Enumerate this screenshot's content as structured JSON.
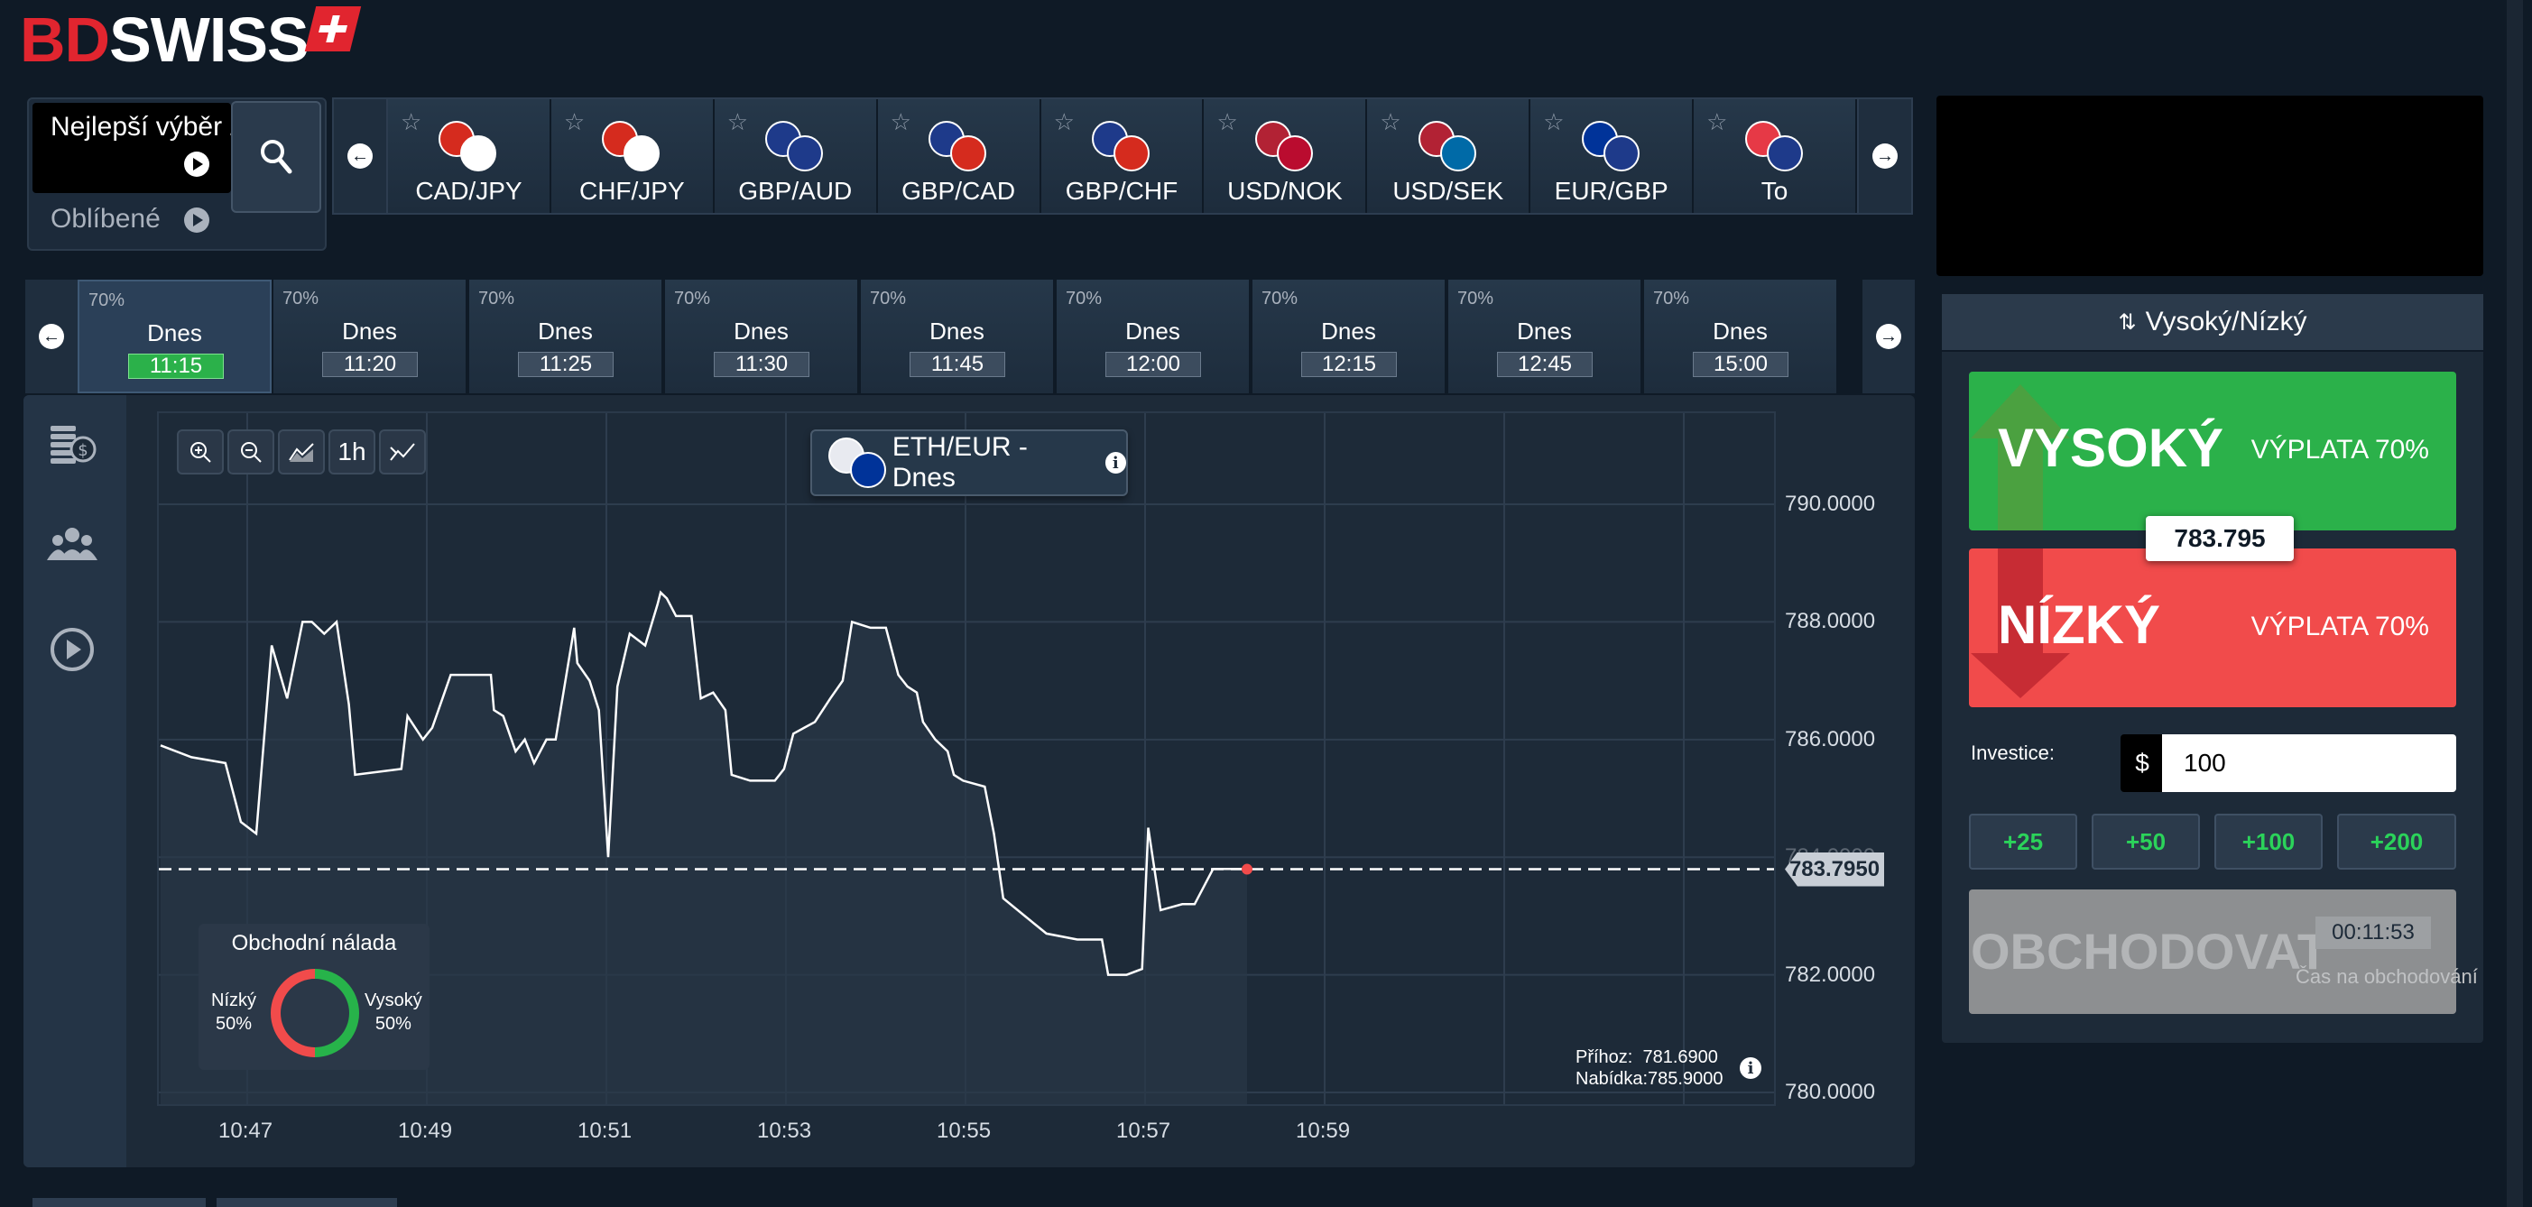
{
  "brand": {
    "part1": "BD",
    "part2": "SWISS"
  },
  "selector": {
    "best_pick": "Nejlepší výběr z",
    "favourites": "Oblíbené"
  },
  "assets": [
    {
      "name": "CAD/JPY",
      "f1": "#d52b1e",
      "f2": "#ffffff"
    },
    {
      "name": "CHF/JPY",
      "f1": "#d52b1e",
      "f2": "#ffffff"
    },
    {
      "name": "GBP/AUD",
      "f1": "#1e3a8a",
      "f2": "#1e3a8a"
    },
    {
      "name": "GBP/CAD",
      "f1": "#1e3a8a",
      "f2": "#d52b1e"
    },
    {
      "name": "GBP/CHF",
      "f1": "#1e3a8a",
      "f2": "#d52b1e"
    },
    {
      "name": "USD/NOK",
      "f1": "#b22234",
      "f2": "#ba0c2f"
    },
    {
      "name": "USD/SEK",
      "f1": "#b22234",
      "f2": "#006aa7"
    },
    {
      "name": "EUR/GBP",
      "f1": "#003399",
      "f2": "#1e3a8a"
    },
    {
      "name": "To",
      "f1": "#e63946",
      "f2": "#1e3a8a"
    }
  ],
  "times": [
    {
      "pct": "70%",
      "day": "Dnes",
      "time": "11:15",
      "active": true
    },
    {
      "pct": "70%",
      "day": "Dnes",
      "time": "11:20"
    },
    {
      "pct": "70%",
      "day": "Dnes",
      "time": "11:25"
    },
    {
      "pct": "70%",
      "day": "Dnes",
      "time": "11:30"
    },
    {
      "pct": "70%",
      "day": "Dnes",
      "time": "11:45"
    },
    {
      "pct": "70%",
      "day": "Dnes",
      "time": "12:00"
    },
    {
      "pct": "70%",
      "day": "Dnes",
      "time": "12:15"
    },
    {
      "pct": "70%",
      "day": "Dnes",
      "time": "12:45"
    },
    {
      "pct": "70%",
      "day": "Dnes",
      "time": "15:00"
    }
  ],
  "chart": {
    "pair": "ETH/EUR - Dnes",
    "timeframe_btn": "1h",
    "current_price": "783.7950",
    "bid": "Příhoz:  781.6900",
    "ask": "Nabídka:785.9000",
    "mood": {
      "title": "Obchodní nálada",
      "low": "Nízký",
      "low_pct": "50%",
      "high": "Vysoký",
      "high_pct": "50%"
    }
  },
  "chart_data": {
    "type": "line",
    "ylim": [
      780,
      791
    ],
    "yticks": [
      "790.0000",
      "788.0000",
      "786.0000",
      "784.0000",
      "782.0000",
      "780.0000"
    ],
    "xticks": [
      "10:47",
      "10:49",
      "10:51",
      "10:53",
      "10:55",
      "10:57",
      "10:59"
    ],
    "current": 783.795,
    "series": [
      {
        "points": [
          [
            10.45,
            785.9
          ],
          [
            10.55,
            785.7
          ],
          [
            10.66,
            785.6
          ],
          [
            10.71,
            784.6
          ],
          [
            10.76,
            784.4
          ],
          [
            10.81,
            787.6
          ],
          [
            10.86,
            786.7
          ],
          [
            10.91,
            788.0
          ],
          [
            10.94,
            788.0
          ],
          [
            10.98,
            787.8
          ],
          [
            11.02,
            788.0
          ],
          [
            11.06,
            786.6
          ],
          [
            11.08,
            785.4
          ],
          [
            11.23,
            785.5
          ],
          [
            11.25,
            786.4
          ],
          [
            11.3,
            786.0
          ],
          [
            11.33,
            786.2
          ],
          [
            11.39,
            787.1
          ],
          [
            11.47,
            787.1
          ],
          [
            11.52,
            787.1
          ],
          [
            11.53,
            786.5
          ],
          [
            11.56,
            786.4
          ],
          [
            11.6,
            785.8
          ],
          [
            11.63,
            786.0
          ],
          [
            11.66,
            785.6
          ],
          [
            11.7,
            786.0
          ],
          [
            11.73,
            786.0
          ],
          [
            11.79,
            787.9
          ],
          [
            11.8,
            787.3
          ],
          [
            11.84,
            787.0
          ],
          [
            11.87,
            786.5
          ],
          [
            11.9,
            784.0
          ],
          [
            11.93,
            786.9
          ],
          [
            11.97,
            787.8
          ],
          [
            12.02,
            787.6
          ],
          [
            12.06,
            788.3
          ],
          [
            12.07,
            788.5
          ],
          [
            12.09,
            788.4
          ],
          [
            12.12,
            788.1
          ],
          [
            12.17,
            788.1
          ],
          [
            12.2,
            786.7
          ],
          [
            12.24,
            786.8
          ],
          [
            12.28,
            786.5
          ],
          [
            12.3,
            785.4
          ],
          [
            12.36,
            785.3
          ],
          [
            12.44,
            785.3
          ],
          [
            12.47,
            785.5
          ],
          [
            12.5,
            786.1
          ],
          [
            12.57,
            786.3
          ],
          [
            12.62,
            786.7
          ],
          [
            12.66,
            787.0
          ],
          [
            12.69,
            788.0
          ],
          [
            12.75,
            787.9
          ],
          [
            12.8,
            787.9
          ],
          [
            12.84,
            787.1
          ],
          [
            12.87,
            786.9
          ],
          [
            12.9,
            786.8
          ],
          [
            12.92,
            786.3
          ],
          [
            12.96,
            786.0
          ],
          [
            13.0,
            785.8
          ],
          [
            13.02,
            785.4
          ],
          [
            13.05,
            785.3
          ],
          [
            13.12,
            785.2
          ],
          [
            13.15,
            784.4
          ],
          [
            13.18,
            783.3
          ],
          [
            13.25,
            783.0
          ],
          [
            13.32,
            782.7
          ],
          [
            13.42,
            782.6
          ],
          [
            13.5,
            782.6
          ],
          [
            13.52,
            782.0
          ],
          [
            13.58,
            782.0
          ],
          [
            13.63,
            782.1
          ],
          [
            13.65,
            784.5
          ],
          [
            13.69,
            783.1
          ],
          [
            13.76,
            783.2
          ],
          [
            13.8,
            783.2
          ],
          [
            13.84,
            783.6
          ],
          [
            13.86,
            783.8
          ],
          [
            13.92,
            783.8
          ],
          [
            13.97,
            783.8
          ]
        ]
      }
    ]
  },
  "trade": {
    "type": "Vysoký/Nízký",
    "high": "VYSOKÝ",
    "low": "NÍZKÝ",
    "payout": "VÝPLATA 70%",
    "price": "783.795",
    "invest_label": "Investice:",
    "currency": "$",
    "amount": "100",
    "quick": [
      "+25",
      "+50",
      "+100",
      "+200"
    ],
    "trade_btn": "OBCHODOVAT",
    "countdown": "00:11:53",
    "countdown_label": "Čas na obchodování"
  },
  "colors": {
    "green": "#2bb14a",
    "red": "#f14b4b",
    "bg": "#0f1a26"
  }
}
